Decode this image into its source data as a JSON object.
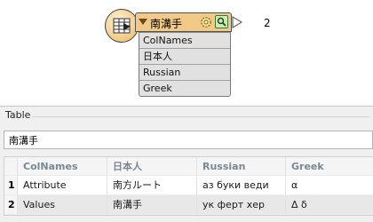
{
  "workspace": {
    "transformer": {
      "name": "南溝手",
      "icon": "table-icon",
      "feature_count": "2",
      "attributes": [
        "ColNames",
        "日本人",
        "Russian",
        "Greek"
      ]
    }
  },
  "table_panel": {
    "label": "Table",
    "table_name": "南溝手",
    "columns": [
      "ColNames",
      "日本人",
      "Russian",
      "Greek"
    ],
    "rows": [
      {
        "num": "1",
        "cells": [
          "Attribute",
          "南方ルート",
          "аз буки веди",
          "α"
        ]
      },
      {
        "num": "2",
        "cells": [
          "Values",
          "南溝手",
          "ук ферт хер",
          "Δ δ"
        ]
      }
    ]
  },
  "colors": {
    "node_header": "#f2c987",
    "attr_list": "#e1e1e1",
    "panel_bg": "#f0f0f0",
    "header_text": "#7a8896",
    "selected_row": "#e8e8e8"
  }
}
